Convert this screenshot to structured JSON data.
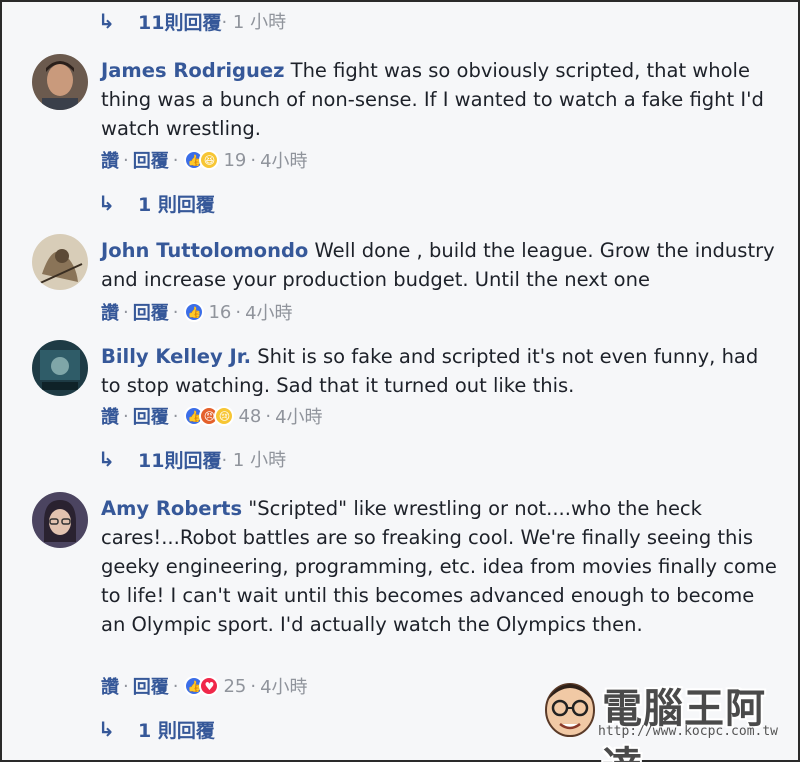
{
  "top_reply": {
    "count_label": "11則回覆",
    "time": "· 1 小時"
  },
  "comments": [
    {
      "name": "James Rodriguez",
      "text": " The fight was so obviously scripted, that whole thing was a bunch of non-sense. If I wanted to watch a fake fight I'd watch wrestling.",
      "like": "讚",
      "reply": "回覆",
      "reaction_count": "19",
      "time": "4小時",
      "reactions": [
        "like",
        "haha"
      ],
      "replies": {
        "label": "1 則回覆",
        "time": ""
      }
    },
    {
      "name": "John Tuttolomondo",
      "text": " Well done , build the league. Grow the industry and increase your production budget. Until the next one",
      "like": "讚",
      "reply": "回覆",
      "reaction_count": "16",
      "time": "4小時",
      "reactions": [
        "like"
      ]
    },
    {
      "name": "Billy Kelley Jr.",
      "text": " Shit is so fake and scripted it's not even funny, had to stop watching. Sad that it turned out like this.",
      "like": "讚",
      "reply": "回覆",
      "reaction_count": "48",
      "time": "4小時",
      "reactions": [
        "like",
        "angry",
        "sad"
      ],
      "replies": {
        "label": "11則回覆",
        "time": "· 1 小時"
      }
    },
    {
      "name": "Amy Roberts",
      "text": " \"Scripted\" like wrestling or not....who the heck cares!...Robot battles are so freaking cool. We're finally seeing this geeky engineering, programming, etc. idea from movies finally come to life! I can't wait until this becomes advanced enough to become an Olympic sport. I'd actually watch the Olympics then.",
      "like": "讚",
      "reply": "回覆",
      "reaction_count": "25",
      "time": "4小時",
      "reactions": [
        "like",
        "love"
      ],
      "replies": {
        "label": "1 則回覆",
        "time": ""
      }
    }
  ],
  "separator": "·",
  "watermark": {
    "title": "電腦王阿達",
    "url": "http://www.kocpc.com.tw"
  }
}
